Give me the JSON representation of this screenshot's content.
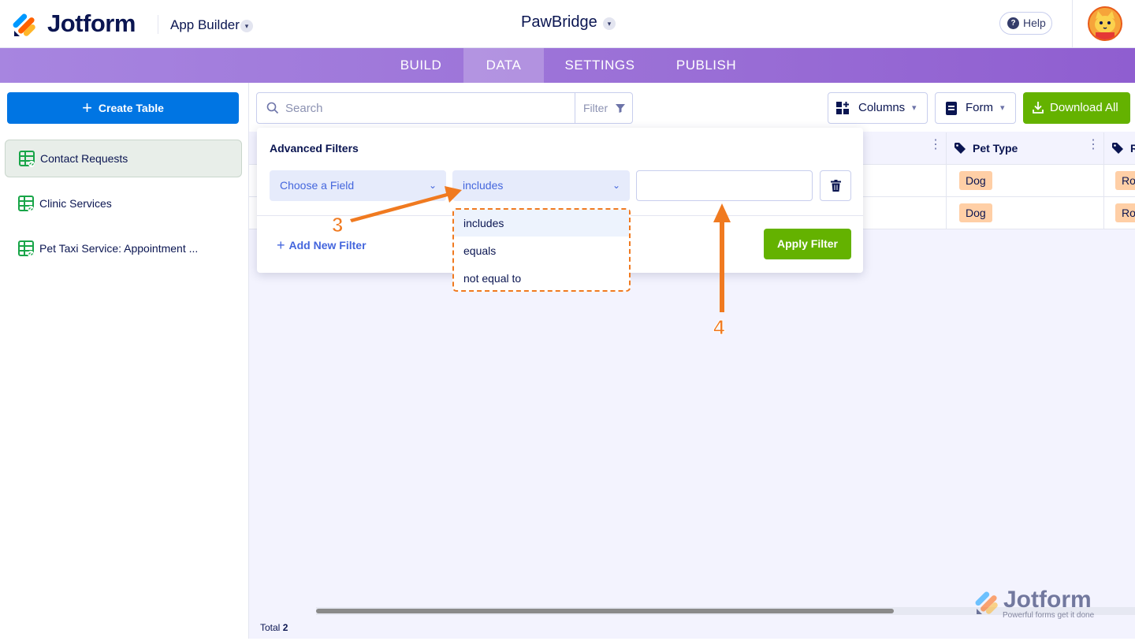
{
  "header": {
    "brand": "Jotform",
    "app_builder_label": "App Builder",
    "app_title": "PawBridge",
    "help_label": "Help"
  },
  "nav": {
    "tabs": [
      {
        "label": "BUILD"
      },
      {
        "label": "DATA"
      },
      {
        "label": "SETTINGS"
      },
      {
        "label": "PUBLISH"
      }
    ],
    "active": "DATA"
  },
  "sidebar": {
    "create_label": "Create Table",
    "items": [
      {
        "label": "Contact Requests",
        "selected": true
      },
      {
        "label": "Clinic Services",
        "selected": false
      },
      {
        "label": "Pet Taxi Service: Appointment ...",
        "selected": false
      }
    ]
  },
  "toolbar": {
    "search_placeholder": "Search",
    "filter_label": "Filter",
    "columns_label": "Columns",
    "form_label": "Form",
    "download_label": "Download All"
  },
  "table": {
    "columns": [
      "Pet Type",
      "R"
    ],
    "rows": [
      {
        "pet_type": "Dog",
        "next": "Ro"
      },
      {
        "pet_type": "Dog",
        "next": "Ro"
      }
    ],
    "total_label": "Total",
    "total_value": "2"
  },
  "filters": {
    "title": "Advanced Filters",
    "field_placeholder": "Choose a Field",
    "operator_value": "includes",
    "operator_options": [
      "includes",
      "equals",
      "not equal to"
    ],
    "add_label": "Add New Filter",
    "apply_label": "Apply Filter"
  },
  "annotations": {
    "step3": "3",
    "step4": "4"
  },
  "watermark": {
    "brand": "Jotform",
    "tagline": "Powerful forms get it done"
  },
  "colors": {
    "accent_blue": "#0075e3",
    "success_green": "#64b200",
    "nav_purple": "#9a6fd6",
    "annotation_orange": "#f07a20",
    "pill_orange": "#ffcfa6"
  }
}
